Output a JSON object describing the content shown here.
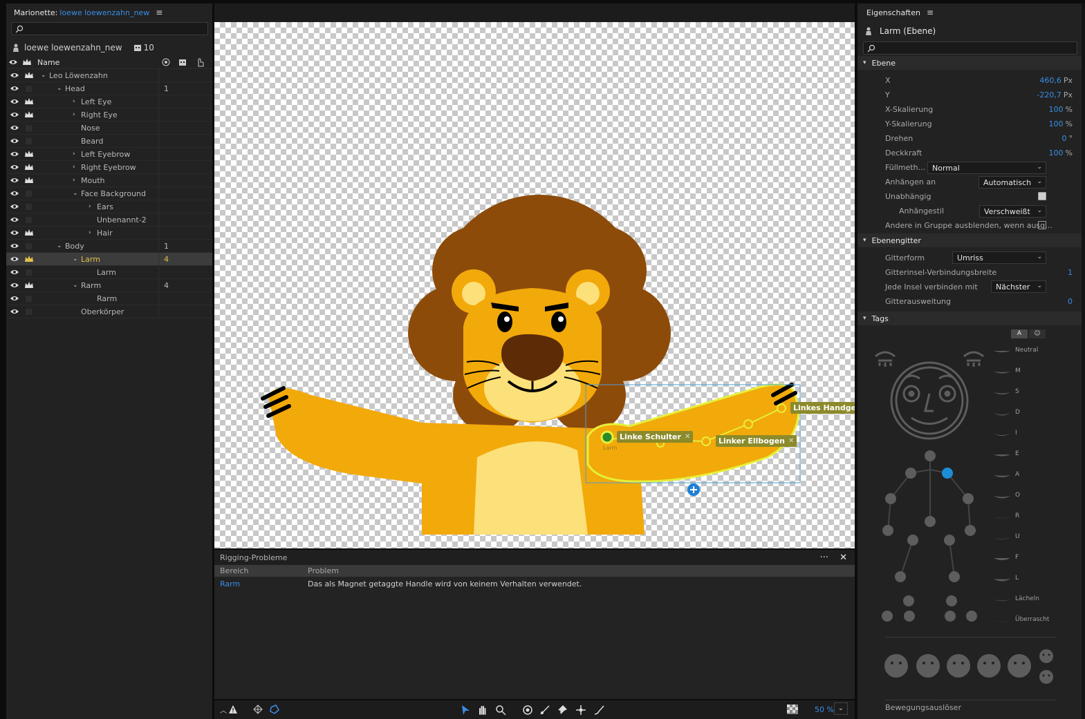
{
  "left_panel": {
    "title_prefix": "Marionette:",
    "title_name": "loewe loewenzahn_new",
    "puppet_name": "loewe loewenzahn_new",
    "scene_count": "10",
    "column_name": "Name"
  },
  "tree": [
    {
      "label": "Leo Löwenzahn",
      "indent": 0,
      "chevron": "down",
      "crown": true,
      "num": ""
    },
    {
      "label": "Head",
      "indent": 1,
      "chevron": "down",
      "crown": false,
      "num": "1"
    },
    {
      "label": "Left Eye",
      "indent": 2,
      "chevron": "right",
      "crown": true,
      "num": ""
    },
    {
      "label": "Right Eye",
      "indent": 2,
      "chevron": "right",
      "crown": true,
      "num": ""
    },
    {
      "label": "Nose",
      "indent": 2,
      "chevron": "",
      "crown": false,
      "num": ""
    },
    {
      "label": "Beard",
      "indent": 2,
      "chevron": "",
      "crown": false,
      "num": ""
    },
    {
      "label": "Left Eyebrow",
      "indent": 2,
      "chevron": "right",
      "crown": true,
      "num": ""
    },
    {
      "label": "Right Eyebrow",
      "indent": 2,
      "chevron": "right",
      "crown": true,
      "num": ""
    },
    {
      "label": "Mouth",
      "indent": 2,
      "chevron": "right",
      "crown": true,
      "num": ""
    },
    {
      "label": "Face Background",
      "indent": 2,
      "chevron": "down",
      "crown": false,
      "num": ""
    },
    {
      "label": "Ears",
      "indent": 3,
      "chevron": "right",
      "crown": false,
      "num": ""
    },
    {
      "label": "Unbenannt-2",
      "indent": 3,
      "chevron": "",
      "crown": false,
      "num": ""
    },
    {
      "label": "Hair",
      "indent": 3,
      "chevron": "right",
      "crown": true,
      "num": ""
    },
    {
      "label": "Body",
      "indent": 1,
      "chevron": "down",
      "crown": false,
      "num": "1"
    },
    {
      "label": "Larm",
      "indent": 2,
      "chevron": "down",
      "crown": true,
      "num": "4",
      "selected": true
    },
    {
      "label": "Larm",
      "indent": 3,
      "chevron": "",
      "crown": false,
      "num": ""
    },
    {
      "label": "Rarm",
      "indent": 2,
      "chevron": "down",
      "crown": true,
      "num": "4"
    },
    {
      "label": "Rarm",
      "indent": 3,
      "chevron": "",
      "crown": false,
      "num": ""
    },
    {
      "label": "Oberkörper",
      "indent": 2,
      "chevron": "",
      "crown": false,
      "num": ""
    }
  ],
  "canvas": {
    "handles": [
      "Linke Schulter",
      "Linker Ellbogen",
      "Linkes Handgelenk"
    ],
    "layer_small_label": "Larm"
  },
  "rigging": {
    "title": "Rigging-Probleme",
    "col_area": "Bereich",
    "col_problem": "Problem",
    "rows": [
      {
        "area": "Rarm",
        "problem": "Das als Magnet getaggte Handle wird von keinem Verhalten verwendet."
      }
    ]
  },
  "toolbar": {
    "zoom": "50 %"
  },
  "right_panel": {
    "title": "Eigenschaften",
    "layer_name": "Larm (Ebene)",
    "sec_ebene": "Ebene",
    "props": [
      {
        "label": "X",
        "value": "460,6",
        "unit": "Px"
      },
      {
        "label": "Y",
        "value": "-220,7",
        "unit": "Px"
      },
      {
        "label": "X-Skalierung",
        "value": "100",
        "unit": "%"
      },
      {
        "label": "Y-Skalierung",
        "value": "100",
        "unit": "%"
      },
      {
        "label": "Drehen",
        "value": "0",
        "unit": "°"
      },
      {
        "label": "Deckkraft",
        "value": "100",
        "unit": "%"
      }
    ],
    "fuellmethode_label": "Füllmeth...",
    "fuellmethode_value": "Normal",
    "anhaengen_label": "Anhängen an",
    "anhaengen_value": "Automatisch",
    "unabhaengig_label": "Unabhängig",
    "anhaengestil_label": "Anhängestil",
    "anhaengestil_value": "Verschweißt",
    "andere_label": "Andere in Gruppe ausblenden, wenn ausg...",
    "sec_gitter": "Ebenengitter",
    "gitterform_label": "Gitterform",
    "gitterform_value": "Umriss",
    "gitterinsel_label": "Gitterinsel-Verbindungsbreite",
    "gitterinsel_value": "1",
    "jede_insel_label": "Jede Insel verbinden mit",
    "jede_insel_value": "Nächster",
    "gitterausweitung_label": "Gitterausweitung",
    "gitterausweitung_value": "0",
    "sec_tags": "Tags",
    "tag_toggle_a": "A",
    "visemes": [
      "Neutral",
      "M",
      "S",
      "D",
      "I",
      "E",
      "A",
      "O",
      "R",
      "U",
      "F",
      "L",
      "Lächeln",
      "Überrascht"
    ],
    "bewegung_label": "Bewegungsauslöser"
  }
}
